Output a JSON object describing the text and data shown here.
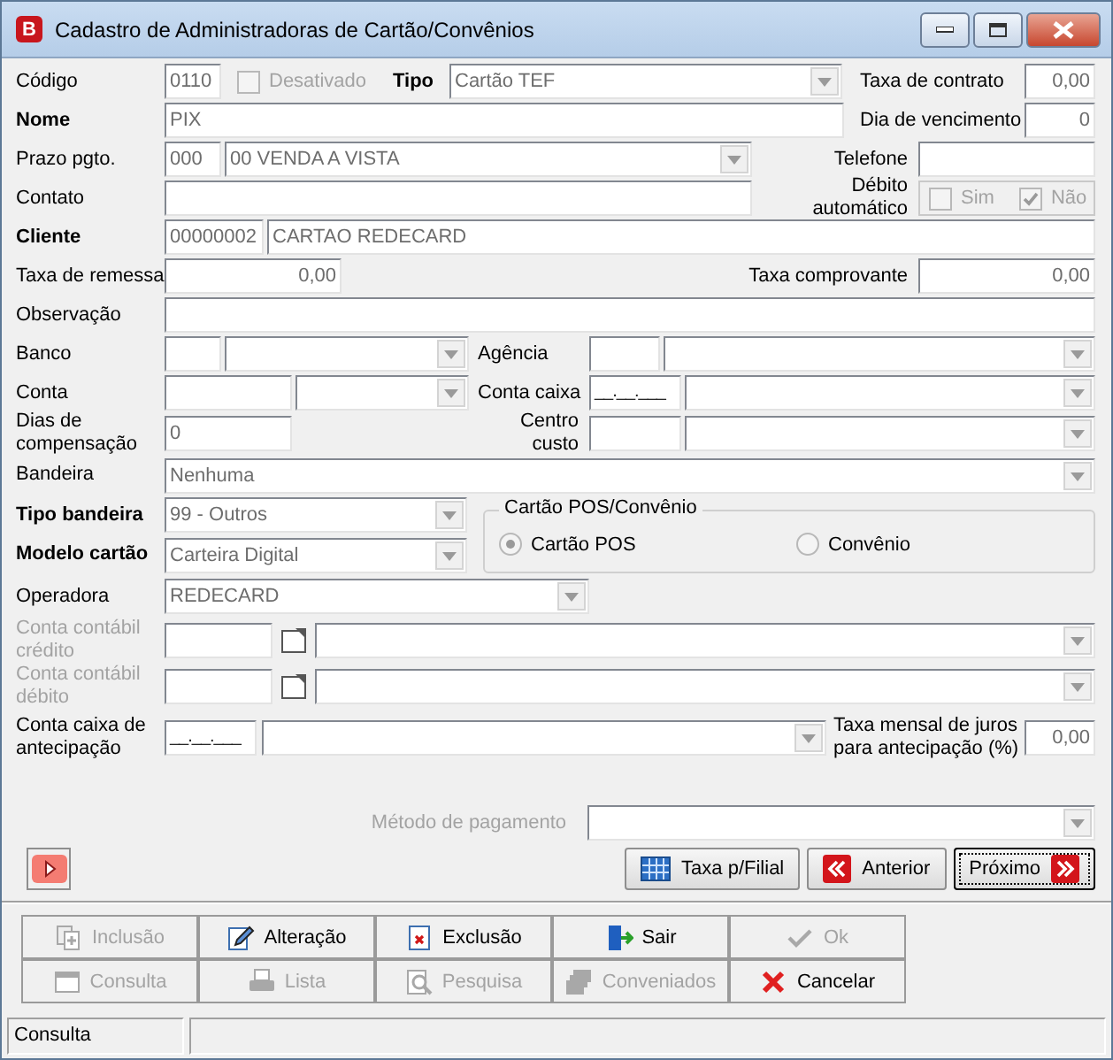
{
  "window": {
    "badge": "B",
    "title": "Cadastro de Administradoras de Cartão/Convênios"
  },
  "form": {
    "codigo": {
      "label": "Código",
      "value": "0110"
    },
    "desativado": {
      "label": "Desativado",
      "checked": false,
      "disabled": true
    },
    "tipo": {
      "label": "Tipo",
      "required": true,
      "value": "Cartão TEF"
    },
    "taxa_contrato": {
      "label": "Taxa de contrato",
      "value": "0,00"
    },
    "nome": {
      "label": "Nome",
      "required": true,
      "value": "PIX"
    },
    "dia_vencimento": {
      "label": "Dia de vencimento",
      "value": "0"
    },
    "prazo": {
      "label": "Prazo pgto.",
      "code": "000",
      "value": "00 VENDA A VISTA"
    },
    "telefone": {
      "label": "Telefone"
    },
    "contato": {
      "label": "Contato"
    },
    "debito_automatico": {
      "label": "Débito automático",
      "options": [
        {
          "label": "Sim",
          "checked": false
        },
        {
          "label": "Não",
          "checked": true
        }
      ]
    },
    "cliente": {
      "label": "Cliente",
      "required": true,
      "code": "00000002",
      "value": "CARTAO REDECARD"
    },
    "taxa_remessa": {
      "label": "Taxa de remessa",
      "value": "0,00"
    },
    "taxa_comprovante": {
      "label": "Taxa comprovante",
      "value": "0,00"
    },
    "observacao": {
      "label": "Observação"
    },
    "banco": {
      "label": "Banco"
    },
    "agencia": {
      "label": "Agência"
    },
    "conta": {
      "label": "Conta"
    },
    "conta_caixa": {
      "label": "Conta caixa",
      "value": "__.__.___"
    },
    "dias_compensacao": {
      "label": "Dias de compensação",
      "value": "0"
    },
    "centro_custo": {
      "label": "Centro custo"
    },
    "bandeira": {
      "label": "Bandeira",
      "value": "Nenhuma"
    },
    "tipo_bandeira": {
      "label": "Tipo bandeira",
      "required": true,
      "value": "99 - Outros"
    },
    "modelo_cartao": {
      "label": "Modelo cartão",
      "required": true,
      "value": "Carteira Digital"
    },
    "cartao_pos_convenio": {
      "title": "Cartão POS/Convênio",
      "options": [
        {
          "label": "Cartão POS",
          "selected": true
        },
        {
          "label": "Convênio",
          "selected": false
        }
      ]
    },
    "operadora": {
      "label": "Operadora",
      "value": "REDECARD"
    },
    "conta_contabil_credito": {
      "label": "Conta contábil crédito",
      "disabled": true
    },
    "conta_contabil_debito": {
      "label": "Conta contábil débito",
      "disabled": true
    },
    "conta_caixa_antecipacao": {
      "label": "Conta caixa de antecipação",
      "value": "__.__.___"
    },
    "taxa_juros": {
      "label": "Taxa mensal de juros para antecipação (%)",
      "value": "0,00"
    },
    "metodo_pagamento": {
      "label": "Método de pagamento",
      "disabled": true
    }
  },
  "nav_buttons": [
    {
      "label": "Taxa p/Filial",
      "kind": "table",
      "focused": false
    },
    {
      "label": "Anterior",
      "kind": "prev",
      "focused": false
    },
    {
      "label": "Próximo",
      "kind": "next",
      "focused": true
    }
  ],
  "toolbar": [
    {
      "label": "Inclusão",
      "kind": "add",
      "disabled": true
    },
    {
      "label": "Alteração",
      "kind": "edit",
      "disabled": false
    },
    {
      "label": "Exclusão",
      "kind": "delete",
      "disabled": false
    },
    {
      "label": "Sair",
      "kind": "exit",
      "disabled": false
    },
    {
      "label": "Ok",
      "kind": "ok",
      "disabled": true
    },
    {
      "label": "Consulta",
      "kind": "view",
      "disabled": true
    },
    {
      "label": "Lista",
      "kind": "print",
      "disabled": true
    },
    {
      "label": "Pesquisa",
      "kind": "search",
      "disabled": true
    },
    {
      "label": "Conveniados",
      "kind": "group",
      "disabled": true
    },
    {
      "label": "Cancelar",
      "kind": "cancel",
      "disabled": false
    }
  ],
  "status_bar": [
    "Consulta"
  ]
}
